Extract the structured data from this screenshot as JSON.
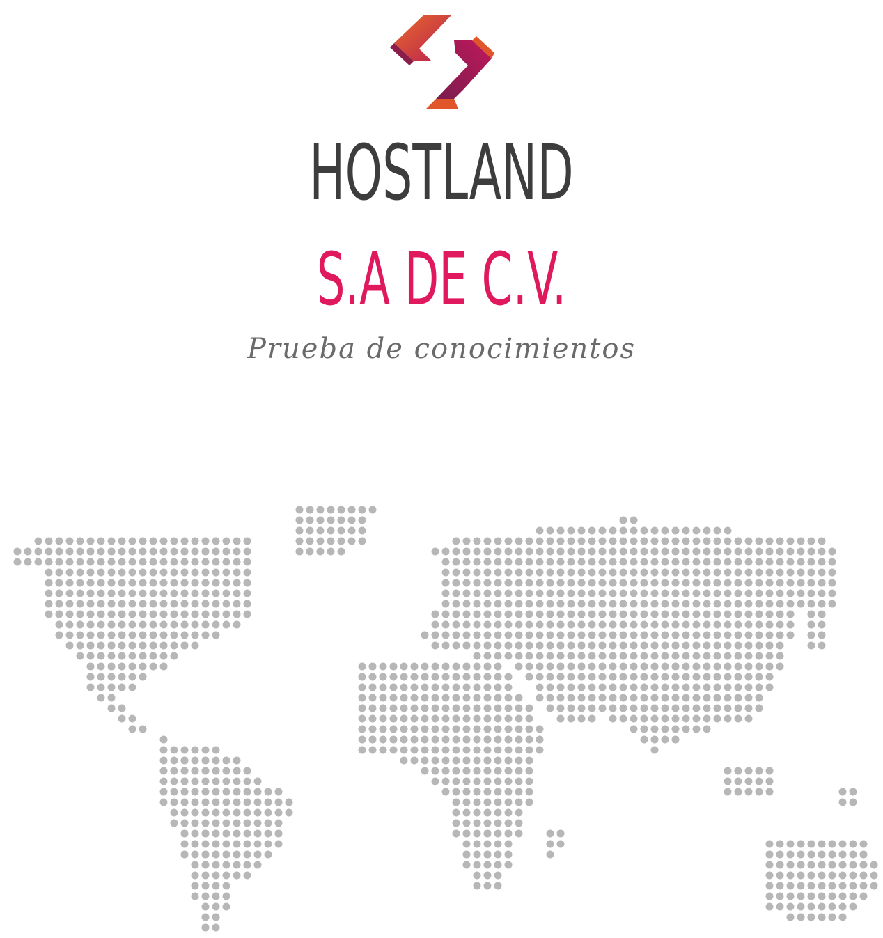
{
  "brand": {
    "name": "HOSTLAND",
    "legal_suffix": "S.A DE C.V.",
    "tagline": "Prueba de conocimientos"
  },
  "colors": {
    "title": "#3d3d3d",
    "accent": "#e0185e",
    "tagline": "#6a6a6a",
    "logo_orange": "#e0562a",
    "logo_magenta": "#b8185a",
    "logo_purple": "#7a1d4e",
    "map_dot": "#b7b7b7"
  },
  "icons": {
    "logo": "hostland-logo-icon",
    "map": "dotted-world-map-icon"
  }
}
